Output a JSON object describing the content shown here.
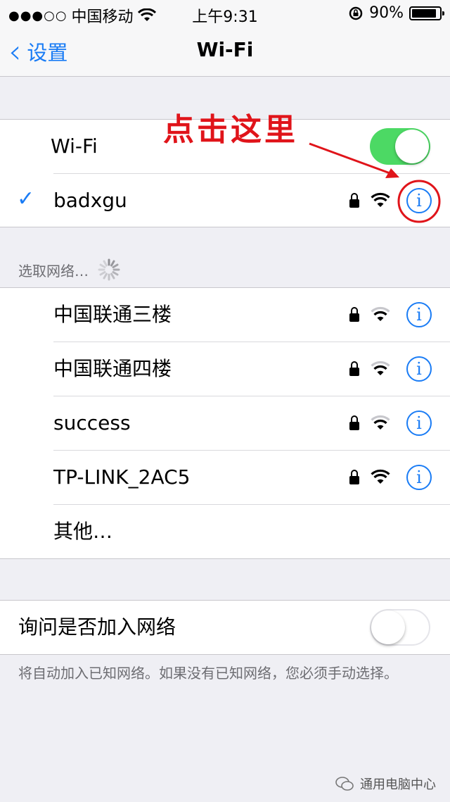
{
  "status_bar": {
    "signal_dots": "●●●○○",
    "carrier": "中国移动",
    "time": "上午9:31",
    "battery_percent": "90%",
    "battery_level": 0.9
  },
  "nav": {
    "back_label": "设置",
    "title": "Wi-Fi"
  },
  "wifi": {
    "label": "Wi-Fi",
    "enabled": true,
    "connected_network": "badxgu",
    "check_mark": "✓"
  },
  "annotation": "点击这里",
  "choose_network": {
    "header": "选取网络…",
    "networks": [
      {
        "name": "中国联通三楼",
        "secured": true
      },
      {
        "name": "中国联通四楼",
        "secured": true
      },
      {
        "name": "success",
        "secured": true
      },
      {
        "name": "TP-LINK_2AC5",
        "secured": true
      }
    ],
    "other_label": "其他…"
  },
  "ask_to_join": {
    "label": "询问是否加入网络",
    "enabled": false,
    "footer": "将自动加入已知网络。如果没有已知网络，您必须手动选择。"
  },
  "watermark": "通用电脑中心",
  "colors": {
    "accent": "#1a7cf5",
    "toggle_on": "#4cd964",
    "annotation_red": "#e0141a"
  },
  "icons": {
    "info": "info-icon",
    "lock": "lock-icon",
    "wifi_signal": "wifi-signal-icon",
    "back": "chevron-left-icon",
    "spinner": "loading-spinner-icon"
  }
}
